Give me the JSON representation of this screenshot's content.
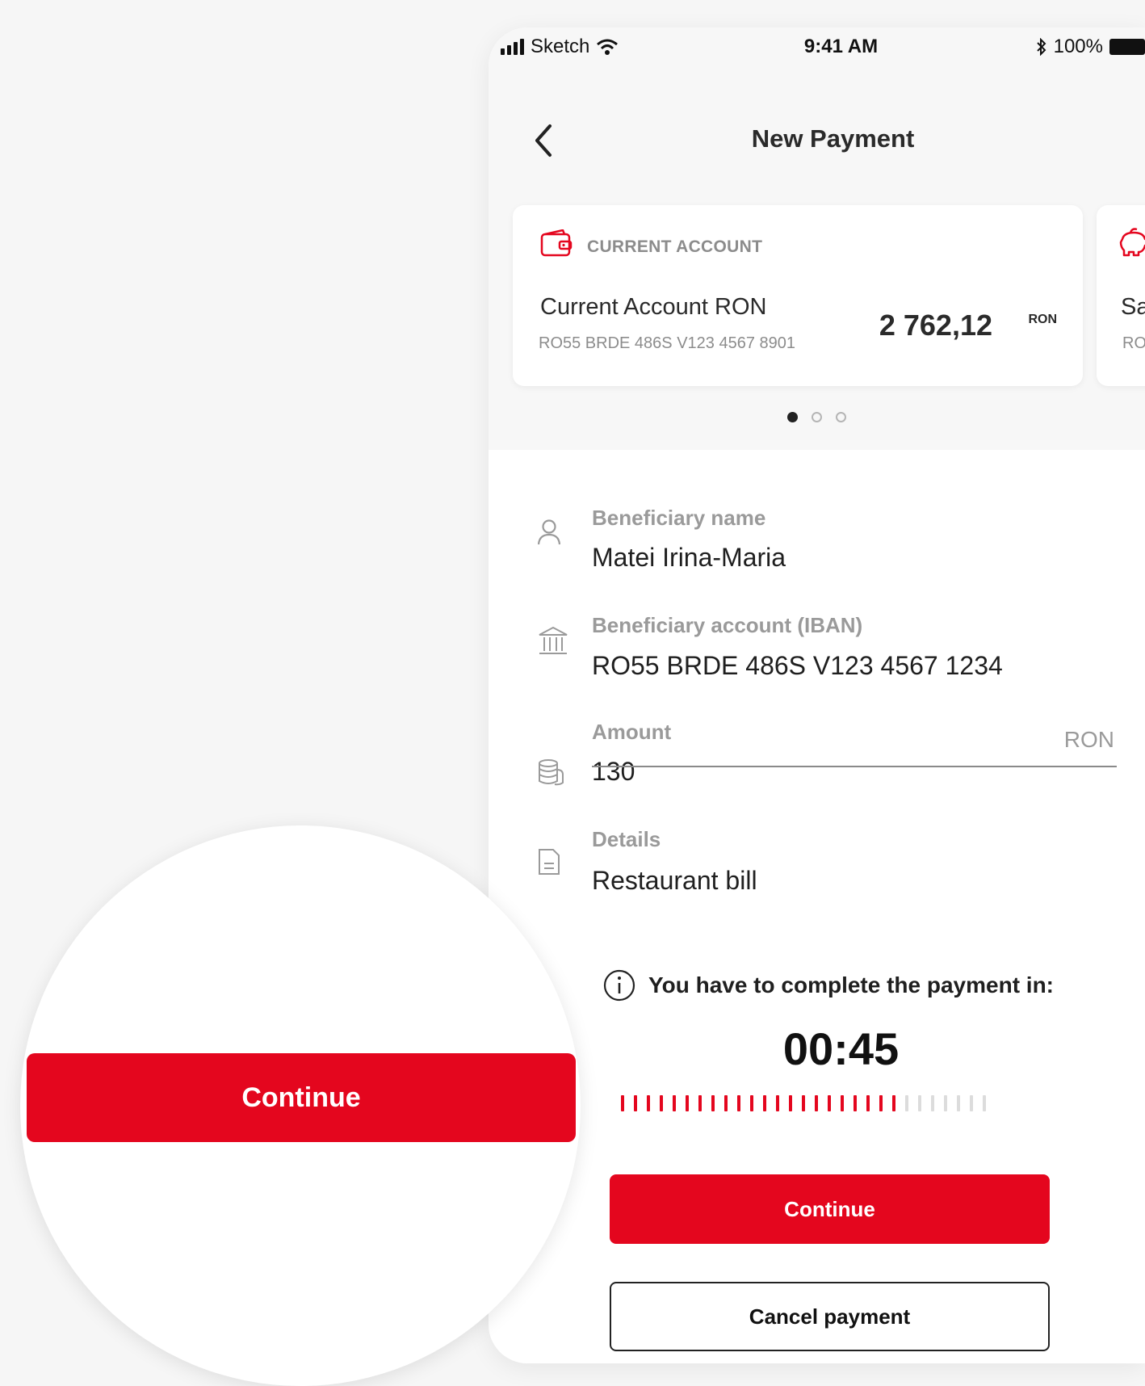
{
  "status_bar": {
    "carrier": "Sketch",
    "time": "9:41 AM",
    "battery": "100%"
  },
  "header": {
    "title": "New Payment"
  },
  "accounts": [
    {
      "type": "CURRENT ACCOUNT",
      "name": "Current Account RON",
      "iban": "RO55 BRDE 486S V123 4567 8901",
      "balance": "2 762,12",
      "currency": "RON"
    },
    {
      "name": "Sa",
      "iban": "RO"
    }
  ],
  "pager": {
    "count": 3,
    "active": 0
  },
  "form": {
    "beneficiary_name_label": "Beneficiary name",
    "beneficiary_name_value": "Matei Irina-Maria",
    "iban_label": "Beneficiary account (IBAN)",
    "iban_value": "RO55 BRDE 486S V123 4567 1234",
    "amount_label": "Amount",
    "amount_value": "130",
    "amount_currency": "RON",
    "details_label": "Details",
    "details_value": "Restaurant bill"
  },
  "timer": {
    "notice": "You have to complete the payment in:",
    "value": "00:45",
    "progress_fraction": 0.75
  },
  "actions": {
    "continue_label": "Continue",
    "cancel_label": "Cancel payment"
  },
  "magnifier": {
    "continue_label": "Continue"
  },
  "colors": {
    "accent": "#e4061e",
    "background": "#f6f6f6"
  },
  "icons": {
    "back": "chevron-left-icon",
    "account": "wallet-icon",
    "savings": "piggy-bank-icon",
    "beneficiary": "person-icon",
    "bank": "bank-icon",
    "amount": "coins-icon",
    "details": "document-icon",
    "info": "info-icon"
  }
}
